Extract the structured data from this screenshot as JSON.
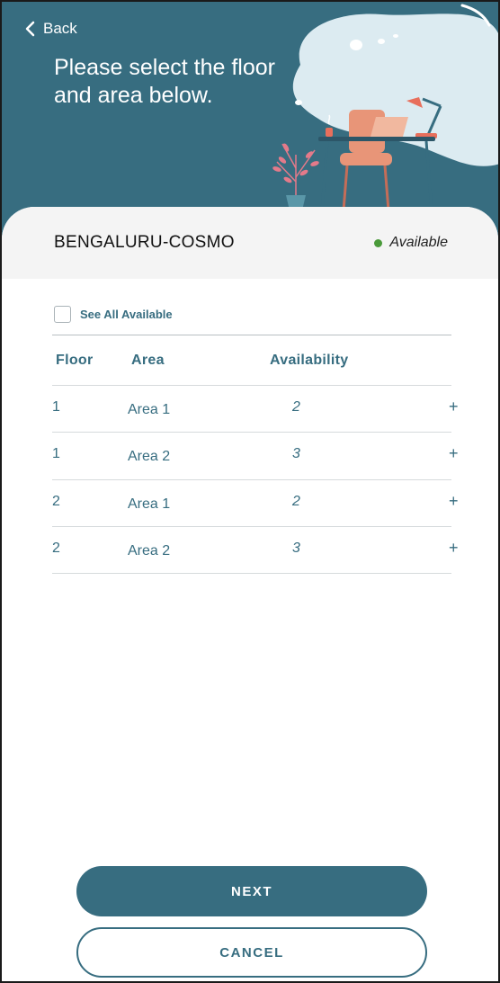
{
  "header": {
    "back_label": "Back",
    "title": "Please select the floor and area below."
  },
  "location": {
    "name": "BENGALURU-COSMO",
    "status": "Available",
    "status_color": "#4a9a3a"
  },
  "filter": {
    "see_all_label": "See All Available",
    "checked": false
  },
  "table": {
    "headers": {
      "floor": "Floor",
      "area": "Area",
      "availability": "Availability"
    },
    "rows": [
      {
        "floor": "1",
        "area": "Area 1",
        "availability": "2",
        "action": "+"
      },
      {
        "floor": "1",
        "area": "Area 2",
        "availability": "3",
        "action": "+"
      },
      {
        "floor": "2",
        "area": "Area 1",
        "availability": "2",
        "action": "+"
      },
      {
        "floor": "2",
        "area": "Area 2",
        "availability": "3",
        "action": "+"
      }
    ]
  },
  "actions": {
    "next_label": "NEXT",
    "cancel_label": "CANCEL"
  },
  "colors": {
    "primary": "#376d80",
    "header_bg": "#376d80",
    "card_header_bg": "#f4f4f4"
  }
}
